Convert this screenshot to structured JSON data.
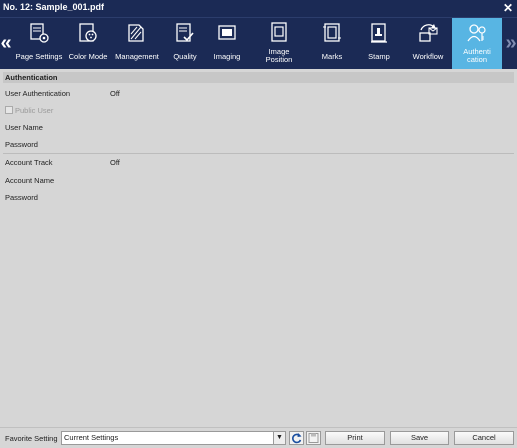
{
  "window": {
    "title": "No. 12: Sample_001.pdf"
  },
  "toolbar": {
    "tabs": [
      {
        "label": "Page Settings",
        "icon": "page-settings-icon"
      },
      {
        "label": "Color Mode",
        "icon": "color-mode-icon"
      },
      {
        "label": "Management",
        "icon": "management-icon"
      },
      {
        "label": "Quality",
        "icon": "quality-icon"
      },
      {
        "label": "Imaging",
        "icon": "imaging-icon"
      },
      {
        "label": "Image Position",
        "icon": "image-position-icon"
      },
      {
        "label": "Marks",
        "icon": "marks-icon"
      },
      {
        "label": "Stamp",
        "icon": "stamp-icon"
      },
      {
        "label": "Workflow",
        "icon": "workflow-icon"
      },
      {
        "label_line1": "Authenti",
        "label_line2": "cation",
        "icon": "authentication-icon",
        "active": true
      }
    ],
    "tab_label_image_position_line1": "Image",
    "tab_label_image_position_line2": "Position",
    "active_color": "#58b5e3",
    "bar_color": "#1b2a55"
  },
  "authentication": {
    "header": "Authentication",
    "user_authentication_label": "User Authentication",
    "user_authentication_value": "Off",
    "public_user_label": "Public User",
    "user_name_label": "User Name",
    "password_label": "Password",
    "account_track_label": "Account Track",
    "account_track_value": "Off",
    "account_name_label": "Account Name",
    "account_password_label": "Password"
  },
  "footer": {
    "favorite_setting_label": "Favorite Setting",
    "favorite_setting_value": "Current Settings",
    "print_label": "Print",
    "save_label": "Save",
    "cancel_label": "Cancel"
  }
}
